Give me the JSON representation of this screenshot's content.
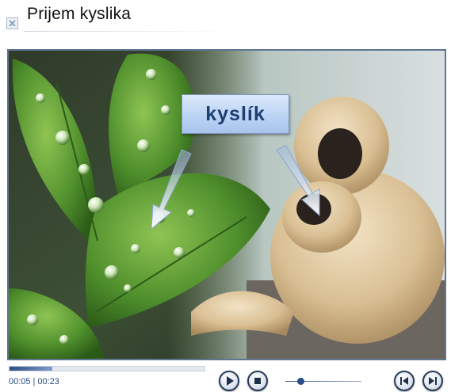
{
  "header": {
    "title": "Prijem kyslika",
    "close_icon": "close-icon"
  },
  "video": {
    "label": "kyslík"
  },
  "player": {
    "current_time": "00:05",
    "separator": "|",
    "duration": "00:23",
    "progress": 0.22,
    "volume": 0.2,
    "icons": {
      "play": "play-icon",
      "stop": "stop-icon",
      "previous": "previous-icon",
      "next": "next-icon"
    }
  }
}
